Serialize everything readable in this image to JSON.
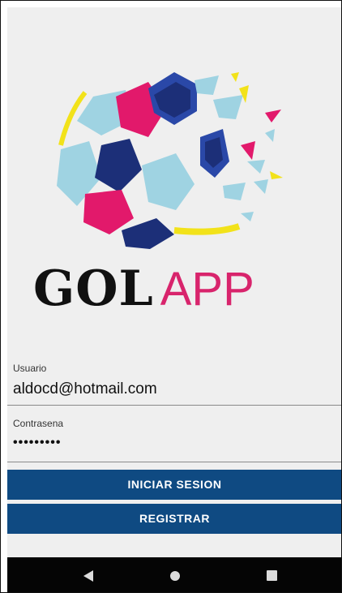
{
  "app": {
    "logo_word_1": "GOL",
    "logo_word_2": "APP",
    "logo_colors": {
      "navy": "#1c2f78",
      "royal": "#2a48a8",
      "pink": "#e2196b",
      "light_blue": "#9fd3e2",
      "yellow": "#f2e21a",
      "text_dark": "#111111",
      "text_pink": "#d8246c"
    }
  },
  "form": {
    "username_label": "Usuario",
    "username_value": "aldocd@hotmail.com",
    "password_label": "Contrasena",
    "password_value": "•••••••••"
  },
  "buttons": {
    "login_label": "INICIAR SESION",
    "register_label": "REGISTRAR",
    "color": "#0f4a82"
  },
  "system_nav": {
    "back_icon": "back-triangle-icon",
    "home_icon": "home-circle-icon",
    "recents_icon": "recents-square-icon"
  }
}
